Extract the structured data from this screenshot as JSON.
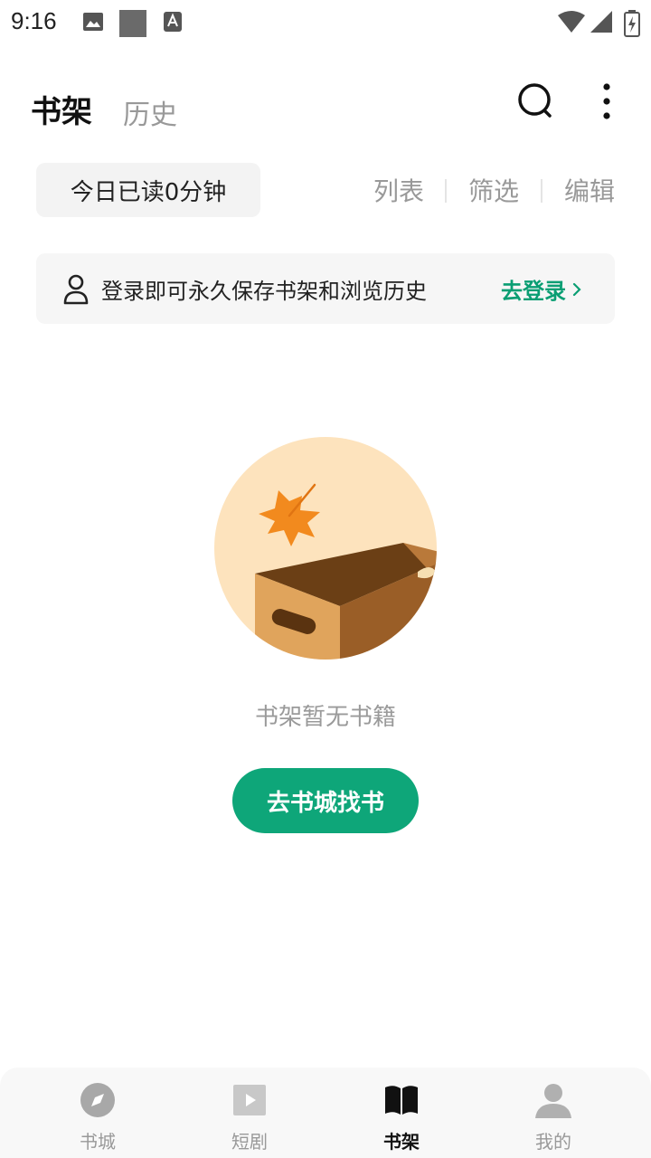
{
  "status_bar": {
    "time": "9:16"
  },
  "header": {
    "tabs": [
      {
        "label": "书架",
        "active": true
      },
      {
        "label": "历史",
        "active": false
      }
    ]
  },
  "toolbar": {
    "reading_time": "今日已读0分钟",
    "actions": [
      "列表",
      "筛选",
      "编辑"
    ]
  },
  "login_banner": {
    "text": "登录即可永久保存书架和浏览历史",
    "link": "去登录"
  },
  "empty_state": {
    "message": "书架暂无书籍",
    "button": "去书城找书"
  },
  "bottom_nav": {
    "items": [
      {
        "label": "书城",
        "icon": "compass-icon"
      },
      {
        "label": "短剧",
        "icon": "play-icon"
      },
      {
        "label": "书架",
        "icon": "book-icon",
        "active": true
      },
      {
        "label": "我的",
        "icon": "person-icon"
      }
    ]
  },
  "colors": {
    "accent": "#0ea679",
    "link": "#0a9e73"
  }
}
